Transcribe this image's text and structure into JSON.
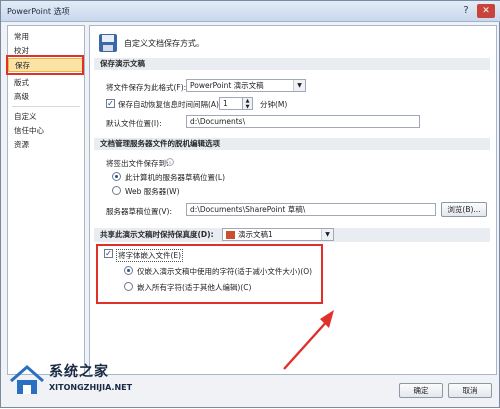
{
  "window": {
    "title": "PowerPoint 选项",
    "help_glyph": "?",
    "close_glyph": "✕"
  },
  "nav": {
    "items": [
      "常用",
      "校对",
      "保存",
      "版式",
      "高级",
      "自定义",
      "信任中心",
      "资源"
    ],
    "selected": "保存"
  },
  "header": {
    "text": "自定义文档保存方式。"
  },
  "save_section": {
    "heading": "保存演示文稿",
    "format_label": "将文件保存为此格式(F):",
    "format_value": "PowerPoint 演示文稿",
    "autorecover_label": "保存自动恢复信息时间间隔(A)",
    "autorecover_checked": true,
    "autorecover_minutes": "1",
    "minutes_unit": "分钟(M)",
    "default_location_label": "默认文件位置(I):",
    "default_location_value": "d:\\Documents\\"
  },
  "server_section": {
    "heading": "文档管理服务器文件的脱机编辑选项",
    "save_to_label": "将签出文件保存到:",
    "radio_local": "此计算机的服务器草稿位置(L)",
    "radio_web": "Web 服务器(W)",
    "selected": "local",
    "drafts_label": "服务器草稿位置(V):",
    "drafts_value": "d:\\Documents\\SharePoint 草稿\\",
    "browse_button": "浏览(B)..."
  },
  "fidelity_section": {
    "heading": "共享此演示文稿时保持保真度(D):",
    "doc_value": "演示文稿1",
    "embed_label": "将字体嵌入文件(E)",
    "embed_checked": true,
    "opt_used_chars": "仅嵌入演示文稿中使用的字符(适于减小文件大小)(O)",
    "opt_all_chars": "嵌入所有字符(适于其他人编辑)(C)",
    "selected": "used"
  },
  "footer": {
    "ok": "确定",
    "cancel": "取消"
  },
  "watermark": {
    "name": "系统之家",
    "url": "XITONGZHIJIA.NET"
  },
  "colors": {
    "highlight": "#e0302a",
    "selected_nav": "#fbe3a5",
    "titlebar": "#c9d8ec"
  }
}
